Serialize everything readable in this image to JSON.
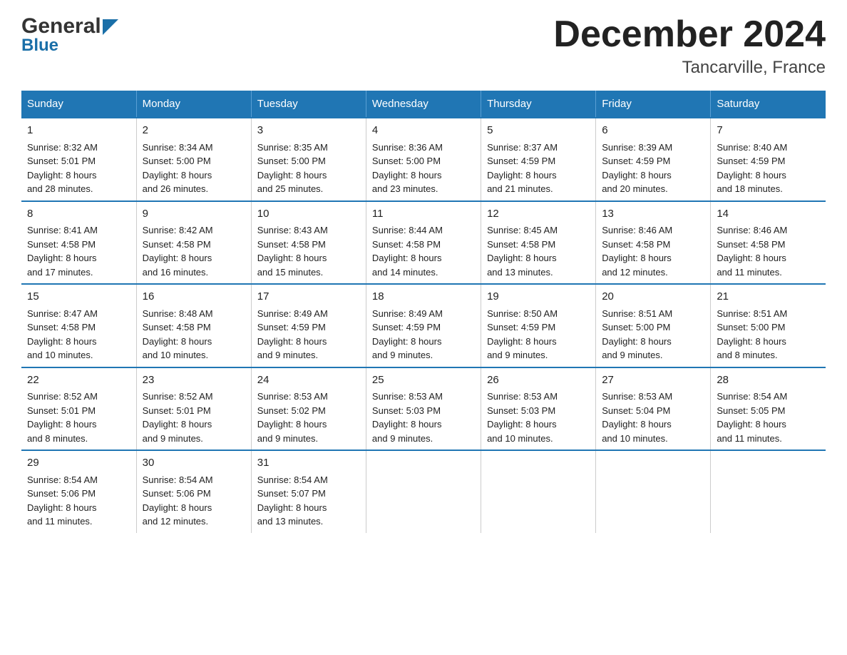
{
  "header": {
    "logo_line1": "General",
    "logo_line2": "Blue",
    "title": "December 2024",
    "subtitle": "Tancarville, France"
  },
  "days_of_week": [
    "Sunday",
    "Monday",
    "Tuesday",
    "Wednesday",
    "Thursday",
    "Friday",
    "Saturday"
  ],
  "weeks": [
    [
      {
        "day": "1",
        "sunrise": "Sunrise: 8:32 AM",
        "sunset": "Sunset: 5:01 PM",
        "daylight": "Daylight: 8 hours",
        "daylight2": "and 28 minutes."
      },
      {
        "day": "2",
        "sunrise": "Sunrise: 8:34 AM",
        "sunset": "Sunset: 5:00 PM",
        "daylight": "Daylight: 8 hours",
        "daylight2": "and 26 minutes."
      },
      {
        "day": "3",
        "sunrise": "Sunrise: 8:35 AM",
        "sunset": "Sunset: 5:00 PM",
        "daylight": "Daylight: 8 hours",
        "daylight2": "and 25 minutes."
      },
      {
        "day": "4",
        "sunrise": "Sunrise: 8:36 AM",
        "sunset": "Sunset: 5:00 PM",
        "daylight": "Daylight: 8 hours",
        "daylight2": "and 23 minutes."
      },
      {
        "day": "5",
        "sunrise": "Sunrise: 8:37 AM",
        "sunset": "Sunset: 4:59 PM",
        "daylight": "Daylight: 8 hours",
        "daylight2": "and 21 minutes."
      },
      {
        "day": "6",
        "sunrise": "Sunrise: 8:39 AM",
        "sunset": "Sunset: 4:59 PM",
        "daylight": "Daylight: 8 hours",
        "daylight2": "and 20 minutes."
      },
      {
        "day": "7",
        "sunrise": "Sunrise: 8:40 AM",
        "sunset": "Sunset: 4:59 PM",
        "daylight": "Daylight: 8 hours",
        "daylight2": "and 18 minutes."
      }
    ],
    [
      {
        "day": "8",
        "sunrise": "Sunrise: 8:41 AM",
        "sunset": "Sunset: 4:58 PM",
        "daylight": "Daylight: 8 hours",
        "daylight2": "and 17 minutes."
      },
      {
        "day": "9",
        "sunrise": "Sunrise: 8:42 AM",
        "sunset": "Sunset: 4:58 PM",
        "daylight": "Daylight: 8 hours",
        "daylight2": "and 16 minutes."
      },
      {
        "day": "10",
        "sunrise": "Sunrise: 8:43 AM",
        "sunset": "Sunset: 4:58 PM",
        "daylight": "Daylight: 8 hours",
        "daylight2": "and 15 minutes."
      },
      {
        "day": "11",
        "sunrise": "Sunrise: 8:44 AM",
        "sunset": "Sunset: 4:58 PM",
        "daylight": "Daylight: 8 hours",
        "daylight2": "and 14 minutes."
      },
      {
        "day": "12",
        "sunrise": "Sunrise: 8:45 AM",
        "sunset": "Sunset: 4:58 PM",
        "daylight": "Daylight: 8 hours",
        "daylight2": "and 13 minutes."
      },
      {
        "day": "13",
        "sunrise": "Sunrise: 8:46 AM",
        "sunset": "Sunset: 4:58 PM",
        "daylight": "Daylight: 8 hours",
        "daylight2": "and 12 minutes."
      },
      {
        "day": "14",
        "sunrise": "Sunrise: 8:46 AM",
        "sunset": "Sunset: 4:58 PM",
        "daylight": "Daylight: 8 hours",
        "daylight2": "and 11 minutes."
      }
    ],
    [
      {
        "day": "15",
        "sunrise": "Sunrise: 8:47 AM",
        "sunset": "Sunset: 4:58 PM",
        "daylight": "Daylight: 8 hours",
        "daylight2": "and 10 minutes."
      },
      {
        "day": "16",
        "sunrise": "Sunrise: 8:48 AM",
        "sunset": "Sunset: 4:58 PM",
        "daylight": "Daylight: 8 hours",
        "daylight2": "and 10 minutes."
      },
      {
        "day": "17",
        "sunrise": "Sunrise: 8:49 AM",
        "sunset": "Sunset: 4:59 PM",
        "daylight": "Daylight: 8 hours",
        "daylight2": "and 9 minutes."
      },
      {
        "day": "18",
        "sunrise": "Sunrise: 8:49 AM",
        "sunset": "Sunset: 4:59 PM",
        "daylight": "Daylight: 8 hours",
        "daylight2": "and 9 minutes."
      },
      {
        "day": "19",
        "sunrise": "Sunrise: 8:50 AM",
        "sunset": "Sunset: 4:59 PM",
        "daylight": "Daylight: 8 hours",
        "daylight2": "and 9 minutes."
      },
      {
        "day": "20",
        "sunrise": "Sunrise: 8:51 AM",
        "sunset": "Sunset: 5:00 PM",
        "daylight": "Daylight: 8 hours",
        "daylight2": "and 9 minutes."
      },
      {
        "day": "21",
        "sunrise": "Sunrise: 8:51 AM",
        "sunset": "Sunset: 5:00 PM",
        "daylight": "Daylight: 8 hours",
        "daylight2": "and 8 minutes."
      }
    ],
    [
      {
        "day": "22",
        "sunrise": "Sunrise: 8:52 AM",
        "sunset": "Sunset: 5:01 PM",
        "daylight": "Daylight: 8 hours",
        "daylight2": "and 8 minutes."
      },
      {
        "day": "23",
        "sunrise": "Sunrise: 8:52 AM",
        "sunset": "Sunset: 5:01 PM",
        "daylight": "Daylight: 8 hours",
        "daylight2": "and 9 minutes."
      },
      {
        "day": "24",
        "sunrise": "Sunrise: 8:53 AM",
        "sunset": "Sunset: 5:02 PM",
        "daylight": "Daylight: 8 hours",
        "daylight2": "and 9 minutes."
      },
      {
        "day": "25",
        "sunrise": "Sunrise: 8:53 AM",
        "sunset": "Sunset: 5:03 PM",
        "daylight": "Daylight: 8 hours",
        "daylight2": "and 9 minutes."
      },
      {
        "day": "26",
        "sunrise": "Sunrise: 8:53 AM",
        "sunset": "Sunset: 5:03 PM",
        "daylight": "Daylight: 8 hours",
        "daylight2": "and 10 minutes."
      },
      {
        "day": "27",
        "sunrise": "Sunrise: 8:53 AM",
        "sunset": "Sunset: 5:04 PM",
        "daylight": "Daylight: 8 hours",
        "daylight2": "and 10 minutes."
      },
      {
        "day": "28",
        "sunrise": "Sunrise: 8:54 AM",
        "sunset": "Sunset: 5:05 PM",
        "daylight": "Daylight: 8 hours",
        "daylight2": "and 11 minutes."
      }
    ],
    [
      {
        "day": "29",
        "sunrise": "Sunrise: 8:54 AM",
        "sunset": "Sunset: 5:06 PM",
        "daylight": "Daylight: 8 hours",
        "daylight2": "and 11 minutes."
      },
      {
        "day": "30",
        "sunrise": "Sunrise: 8:54 AM",
        "sunset": "Sunset: 5:06 PM",
        "daylight": "Daylight: 8 hours",
        "daylight2": "and 12 minutes."
      },
      {
        "day": "31",
        "sunrise": "Sunrise: 8:54 AM",
        "sunset": "Sunset: 5:07 PM",
        "daylight": "Daylight: 8 hours",
        "daylight2": "and 13 minutes."
      },
      {
        "day": "",
        "sunrise": "",
        "sunset": "",
        "daylight": "",
        "daylight2": ""
      },
      {
        "day": "",
        "sunrise": "",
        "sunset": "",
        "daylight": "",
        "daylight2": ""
      },
      {
        "day": "",
        "sunrise": "",
        "sunset": "",
        "daylight": "",
        "daylight2": ""
      },
      {
        "day": "",
        "sunrise": "",
        "sunset": "",
        "daylight": "",
        "daylight2": ""
      }
    ]
  ]
}
